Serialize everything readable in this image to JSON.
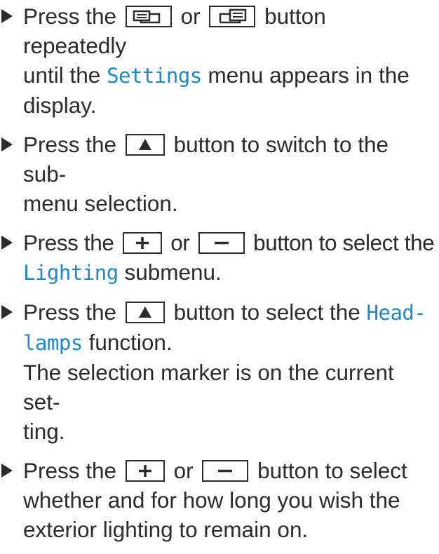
{
  "steps": [
    {
      "pre": "Press the",
      "mid": "or",
      "post": "button repeatedly",
      "line2_pre": "until the",
      "highlight": "Settings",
      "line2_post": "menu appears in the",
      "line3": "display.",
      "buttons": [
        "display-left-icon",
        "display-right-icon"
      ]
    },
    {
      "pre": "Press the",
      "post": "button to switch to the sub-",
      "line2": "menu selection.",
      "buttons": [
        "up-arrow-icon"
      ]
    },
    {
      "pre": "Press the",
      "mid": "or",
      "post": "button to select the",
      "highlight": "Lighting",
      "line2_post": "submenu.",
      "buttons": [
        "plus-icon",
        "minus-icon"
      ]
    },
    {
      "pre": "Press the",
      "post": "button to select the",
      "highlight_a": "Head-",
      "highlight_b": "lamps",
      "line2_post": "function.",
      "note_1": "The selection marker is on the current set-",
      "note_2": "ting.",
      "buttons": [
        "up-arrow-icon"
      ]
    },
    {
      "pre": "Press the",
      "mid": "or",
      "post": "button to select",
      "line2": "whether and for how long you wish the",
      "line3": "exterior lighting to remain on.",
      "buttons": [
        "plus-icon",
        "minus-icon"
      ]
    }
  ]
}
